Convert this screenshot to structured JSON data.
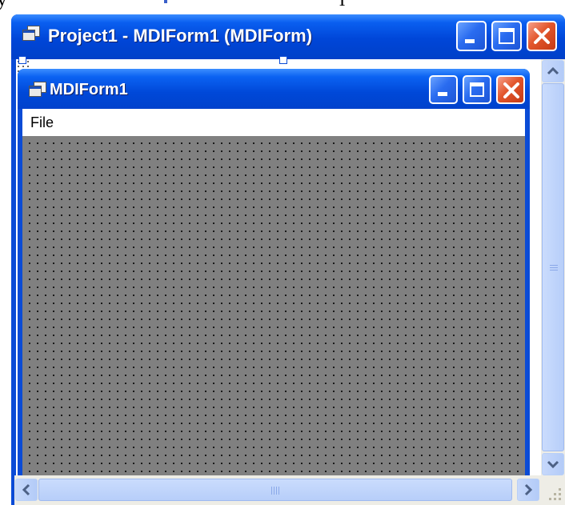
{
  "outer_window": {
    "title": "Project1 - MDIForm1 (MDIForm)",
    "icon": "form-icon",
    "controls": [
      "minimize",
      "maximize",
      "close"
    ]
  },
  "mdi_window": {
    "title": "MDIForm1",
    "icon": "form-icon",
    "controls": [
      "minimize",
      "maximize",
      "close"
    ],
    "menu": [
      {
        "label": "File"
      }
    ]
  },
  "colors": {
    "titlebar": "#0047d6",
    "close_button": "#d9471f",
    "mdi_client_background": "#808080",
    "menubar_background": "#ffffff",
    "scrollbar_thumb": "#c0d4fb"
  },
  "icons": {
    "scroll_up": "chevron-up-icon",
    "scroll_down": "chevron-down-icon",
    "scroll_left": "chevron-left-icon",
    "scroll_right": "chevron-right-icon",
    "size_grip": "resize-grip-icon"
  }
}
